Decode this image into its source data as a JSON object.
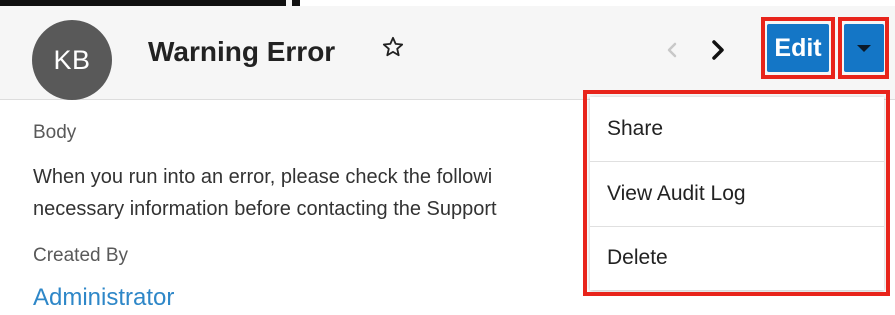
{
  "record": {
    "avatar_initials": "KB",
    "title": "Warning Error",
    "favorite_icon": "star-outline-icon"
  },
  "navigation": {
    "prev_icon": "chevron-left-icon",
    "next_icon": "chevron-right-icon"
  },
  "actions": {
    "edit_label": "Edit",
    "dropdown_icon": "caret-down-icon",
    "menu_items": [
      {
        "label": "Share"
      },
      {
        "label": "View Audit Log"
      },
      {
        "label": "Delete"
      }
    ]
  },
  "fields": {
    "body_label": "Body",
    "body_line1": "When you run into an error, please check the followi",
    "body_line2": "necessary information before contacting the Support",
    "created_by_label": "Created By",
    "created_by_value": "Administrator"
  },
  "colors": {
    "primary_button": "#1476c6",
    "highlight_border": "#e8241b",
    "link": "#2e87c8",
    "avatar": "#595959",
    "header_background": "#f6f6f6"
  }
}
